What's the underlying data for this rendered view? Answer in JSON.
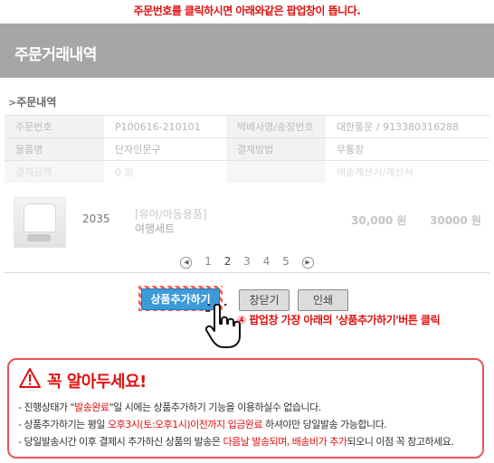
{
  "top_instruction": "주문번호를 클릭하시면 아래와같은 팝업창이 뜹니다.",
  "window": {
    "title": "주문거래내역"
  },
  "section": {
    "arrow": ">",
    "label": "주문내역"
  },
  "info_rows": [
    {
      "h1": "주문번호",
      "v1": "P100616-210101",
      "h2": "택배사명/송장번호",
      "v2": "대한통운 / 913380316288"
    },
    {
      "h1": "물품명",
      "v1": "단자인문구",
      "h2": "결제방법",
      "v2": "무통장"
    },
    {
      "h1": "결제금액",
      "v1": "0 원",
      "h2": "",
      "v2": "배송계산서/계산서"
    }
  ],
  "product": {
    "code": "2035",
    "category": "[유아/아동용품]",
    "name": "여행세트",
    "price": "30,000 원",
    "total": "30000 원"
  },
  "pager": {
    "prev_icon": "◀",
    "next_icon": "▶",
    "pages": [
      "1",
      "2",
      "3",
      "4",
      "5"
    ],
    "current": "2"
  },
  "buttons": {
    "add": "상품추가하기",
    "close": "창닫기",
    "print": "인쇄"
  },
  "step_note": {
    "num": "④",
    "text": "팝업창 가장 아래의 '상품추가하기'버튼 클릭"
  },
  "notice": {
    "heading": "꼭 알아두세요!",
    "warn_icon": "warning-triangle-icon",
    "line1": {
      "a": "- 진행상태가 \"",
      "b": "발송완료",
      "c": "\"일 시에는 상품추가하기 기능을 이용하실수 없습니다."
    },
    "line2": {
      "a": "- 상품추가하기는 평일 ",
      "b": "오후3시(토:오후1시)이전까지 입금완료",
      "c": " 하셔야만 당일발송 가능합니다."
    },
    "line3": {
      "a": "- 당일발송시간 이후 결제시 추가하신 상품의 발송은 ",
      "b": "다음날 발송되며, 배송비가 추가",
      "c": "되오니 이점 꼭 참고하세요."
    }
  },
  "colors": {
    "accent_red": "#e01010",
    "titlebar": "#a6a6a6",
    "button_blue": "#3d9ad8"
  }
}
